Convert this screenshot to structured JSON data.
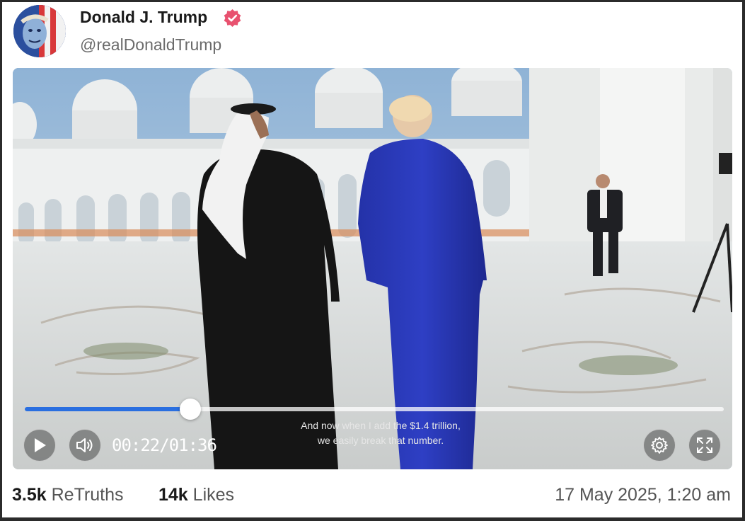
{
  "post": {
    "author_name": "Donald J. Trump",
    "author_handle": "@realDonaldTrump",
    "verified": true,
    "accent_color": "#e8516f"
  },
  "video": {
    "current_time": "00:22",
    "separator": "/",
    "duration": "01:36",
    "progress": 0.237,
    "progress_color": "#2a6fe0",
    "caption_line1": "And now when I add the $1.4 trillion,",
    "caption_line2": "we easily break that number.",
    "controls": {
      "play_icon": "play-icon",
      "volume_icon": "volume-icon",
      "settings_icon": "gear-icon",
      "fullscreen_icon": "fullscreen-icon"
    }
  },
  "stats": {
    "retruths_count": "3.5k",
    "retruths_label": "ReTruths",
    "likes_count": "14k",
    "likes_label": "Likes",
    "timestamp": "17 May 2025, 1:20 am"
  }
}
